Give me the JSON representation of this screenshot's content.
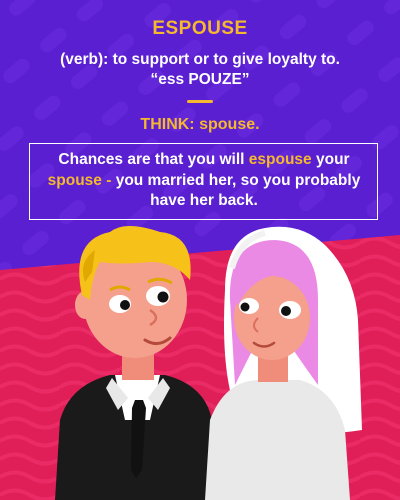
{
  "card": {
    "word": "ESPOUSE",
    "definition_line1": "(verb): to support or to give loyalty to.",
    "definition_line2": "“ess POUZE”",
    "think_label": "THINK:",
    "think_word": "spouse.",
    "sentence": {
      "part1": "Chances are that you will ",
      "hl1": "espouse",
      "part2": " your ",
      "hl2": "spouse -",
      "part3": " you married her, so you probably have her back."
    }
  },
  "colors": {
    "background_top": "#5a1fd0",
    "background_bottom": "#e8205a",
    "accent": "#f5b82e",
    "text": "#ffffff"
  }
}
